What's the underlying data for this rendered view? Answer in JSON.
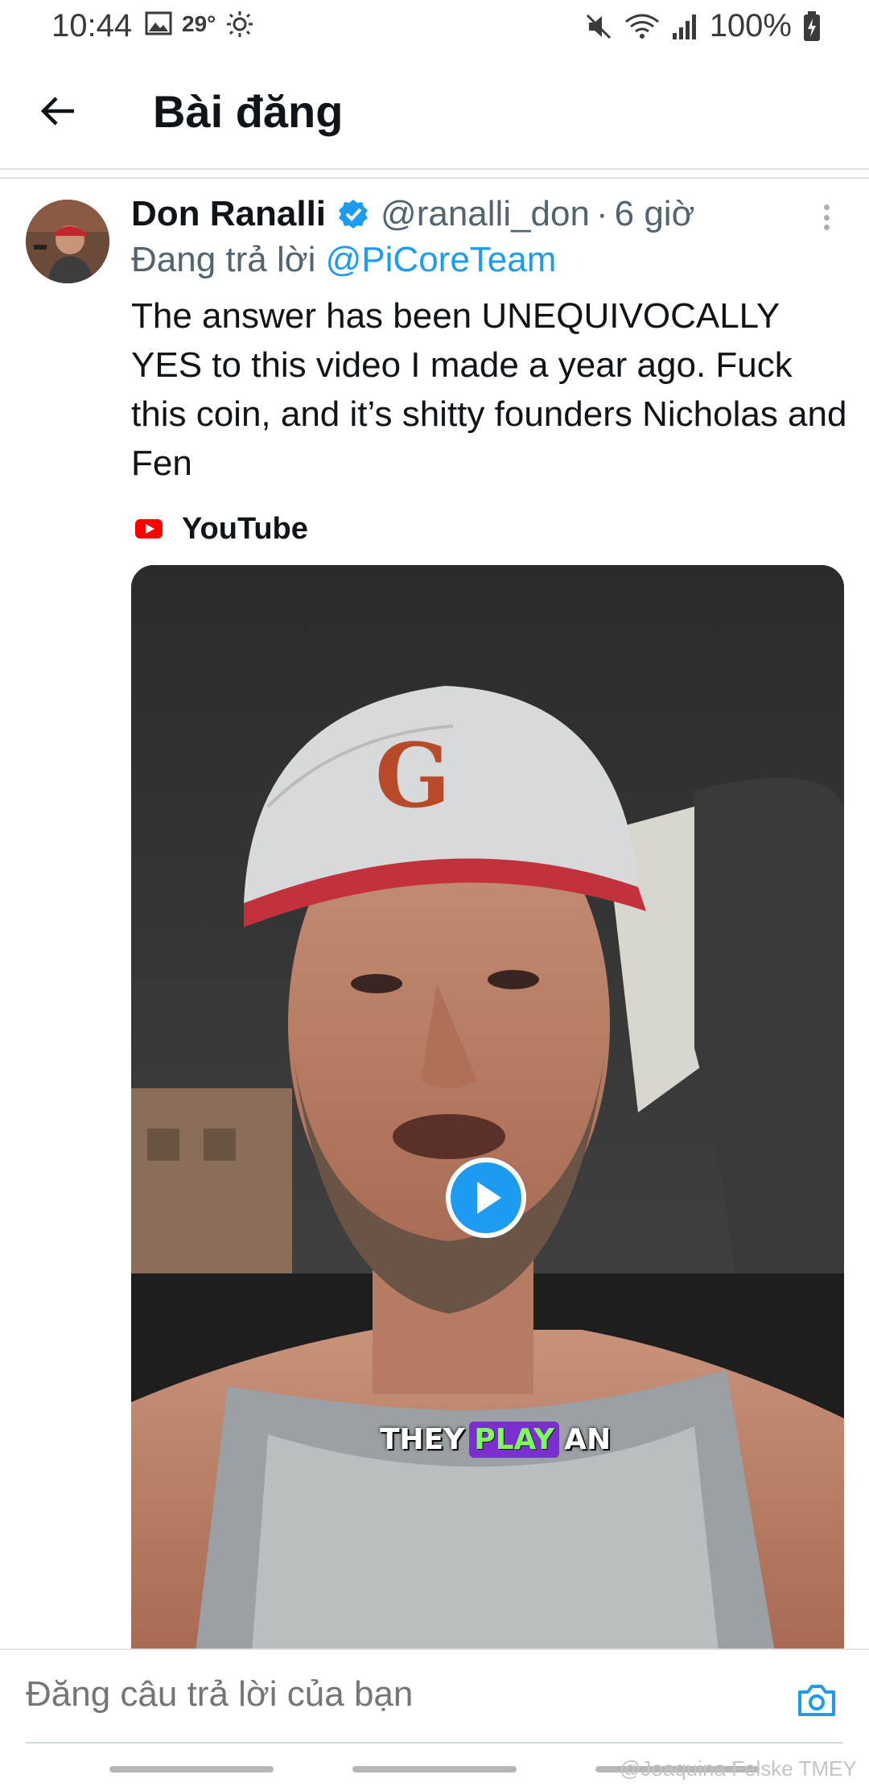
{
  "status_bar": {
    "time": "10:44",
    "temperature": "29°",
    "battery": "100%"
  },
  "header": {
    "title": "Bài đăng"
  },
  "post": {
    "author_name": "Don Ranalli",
    "handle": "@ranalli_don",
    "separator": "·",
    "time": "6 giờ",
    "reply_prefix": "Đang trả lời",
    "reply_mention": "@PiCoreTeam",
    "text": "The answer has been UNEQUIVOCALLY YES to this video I made a year ago. Fuck this coin, and it’s shitty founders Nicholas and Fen",
    "source_label": "YouTube",
    "video": {
      "caption_before": "THEY",
      "caption_highlight": "PLAY",
      "caption_after": "AN"
    }
  },
  "composer": {
    "placeholder": "Đăng câu trả lời của bạn"
  },
  "watermark": "@Joaquina Felske TMEY",
  "colors": {
    "accent": "#1d9bf0",
    "secondary_text": "#536471",
    "youtube_red": "#ff0000"
  },
  "icons": {
    "back": "arrow-left-icon",
    "verified": "verified-badge-icon",
    "more": "more-vertical-icon",
    "source": "youtube-icon",
    "play": "play-icon",
    "camera": "camera-icon"
  }
}
